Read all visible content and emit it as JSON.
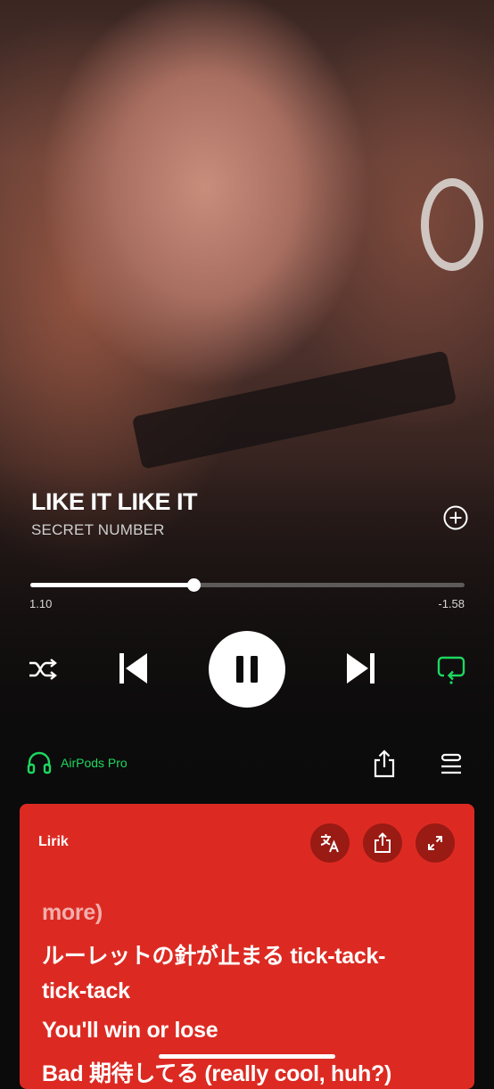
{
  "track": {
    "title": "LIKE IT LIKE IT",
    "artist": "SECRET NUMBER"
  },
  "playback": {
    "elapsed": "1.10",
    "remaining": "-1.58",
    "progress_fraction": 0.375,
    "state": "playing",
    "shuffle": false,
    "repeat": true
  },
  "device": {
    "name": "AirPods Pro",
    "icon": "headphones-icon",
    "color": "#1ed760"
  },
  "lyrics": {
    "label": "Lirik",
    "background": "#dc2a22",
    "lines": [
      "more)",
      "ルーレットの針が止まる tick-tack-",
      "tick-tack",
      "You'll win or lose",
      "Bad 期待してる (really cool, huh?)"
    ]
  },
  "colors": {
    "accent": "#1ed760",
    "text_primary": "#ffffff",
    "text_secondary": "#cfcfcf"
  }
}
